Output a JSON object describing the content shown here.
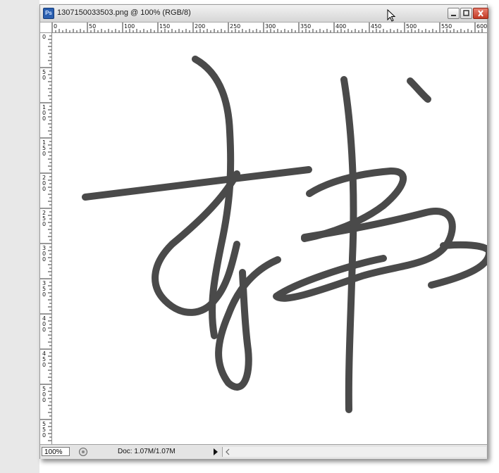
{
  "window": {
    "title": "1307150033503.png @ 100% (RGB/8)",
    "app_icon_label": "Ps",
    "controls": {
      "minimize_icon": "minimize-icon",
      "restore_icon": "restore-icon",
      "close_icon": "close-icon"
    }
  },
  "ruler": {
    "top_labels": [
      "0",
      "50",
      "100",
      "150",
      "200",
      "250",
      "300",
      "350",
      "400",
      "450",
      "500",
      "550",
      "600"
    ],
    "left_labels": [
      "0",
      "50",
      "100",
      "150",
      "200",
      "250",
      "300",
      "350",
      "400",
      "450",
      "500",
      "550"
    ]
  },
  "status_bar": {
    "zoom": "100%",
    "doc_info": "Doc: 1.07M/1.07M"
  },
  "colors": {
    "ink": "#4a4a4a",
    "window_bg": "#d9d9d9",
    "close_button": "#c23a24"
  }
}
